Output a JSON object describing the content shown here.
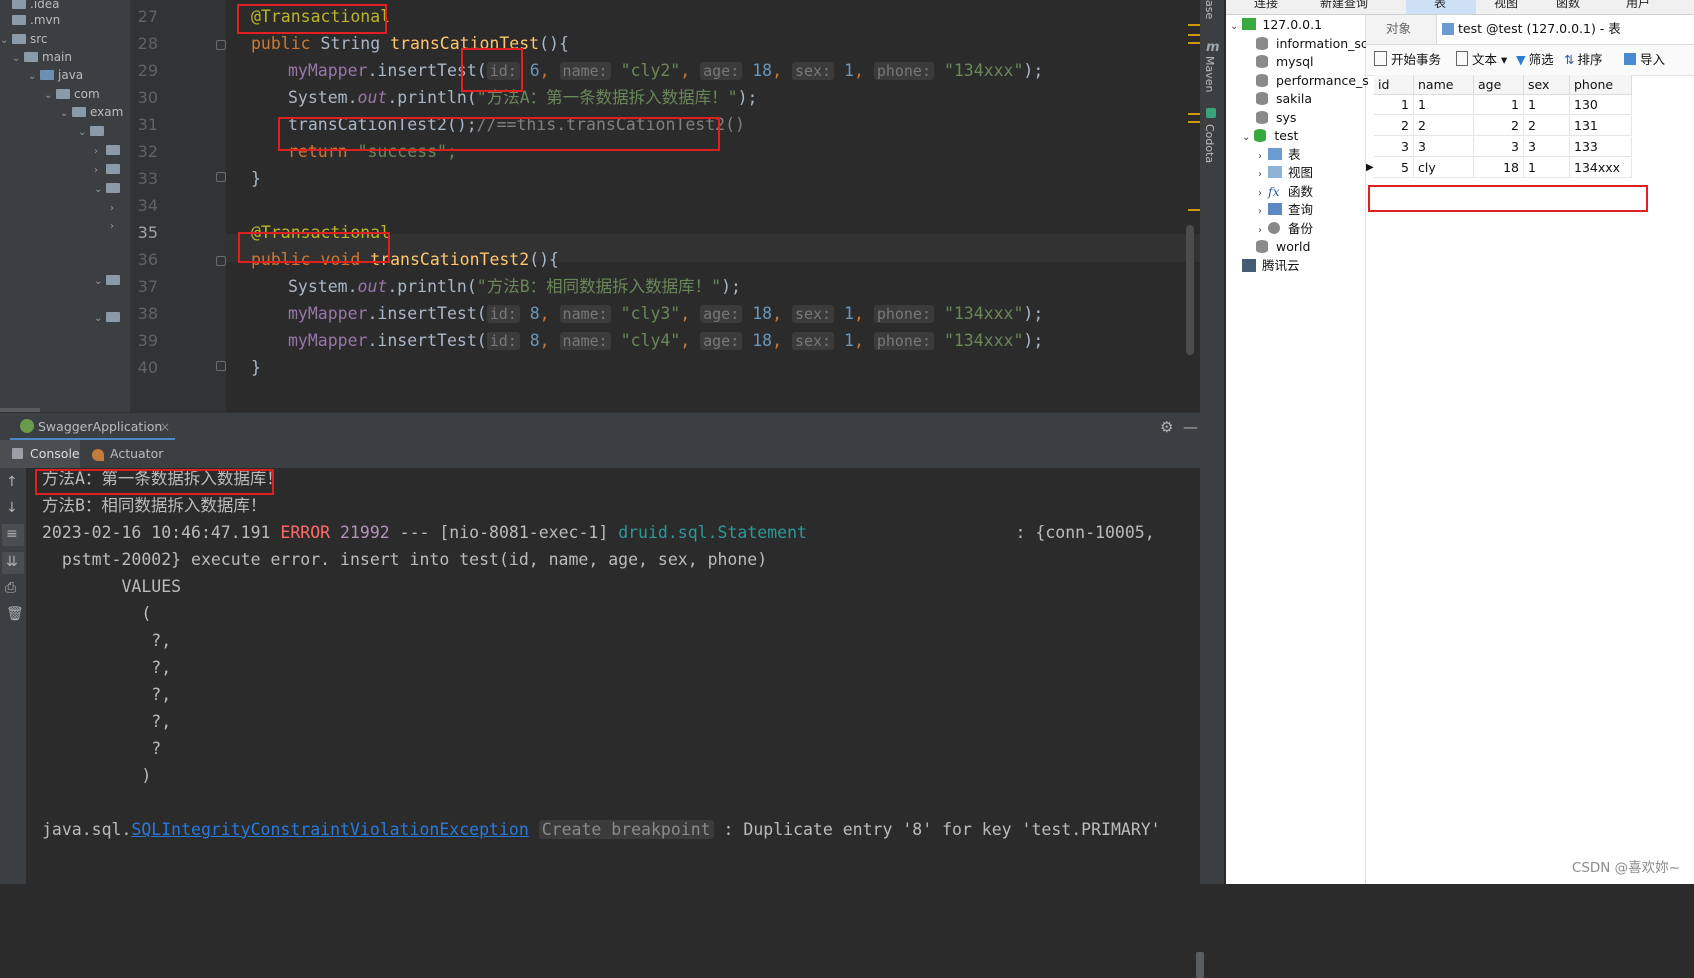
{
  "project_tree": [
    {
      "label": ".idea",
      "indent": 0
    },
    {
      "label": ".mvn",
      "indent": 0
    },
    {
      "label": "src",
      "indent": 0
    },
    {
      "label": "main",
      "indent": 1
    },
    {
      "label": "java",
      "indent": 2
    },
    {
      "label": "com",
      "indent": 3
    },
    {
      "label": "exam",
      "indent": 4
    }
  ],
  "editor": {
    "line_numbers": [
      "27",
      "28",
      "29",
      "30",
      "31",
      "32",
      "33",
      "34",
      "35",
      "36",
      "37",
      "38",
      "39",
      "40"
    ],
    "current_line": "35",
    "annotation_1": "@Transactional",
    "kw_public": "public",
    "type_string": "String",
    "method_a": "transCationTest",
    "parens_open": "(){",
    "mapper": "myMapper",
    "insert": ".insertTest(",
    "hint_id": "id:",
    "hint_name": "name:",
    "hint_age": "age:",
    "hint_sex": "sex:",
    "hint_phone": "phone:",
    "v6": "6",
    "v8": "8",
    "v18": "18",
    "v1": "1",
    "s_cly2": "\"cly2\"",
    "s_cly3": "\"cly3\"",
    "s_cly4": "\"cly4\"",
    "s_phone": "\"134xxx\"",
    "close_stmt": ");",
    "comma": ",",
    "sys": "System.",
    "out": "out",
    "println": ".println(",
    "msg_a": "\"方法A：第一条数据拆入数据库！\"",
    "msg_b": "\"方法B：相同数据拆入数据库！\"",
    "call_b": "transCationTest2();",
    "comment": "//==this.transCationTest2()",
    "kw_return": "return",
    "s_success": "\"success\";",
    "brace_close": "}",
    "annotation_2": "@Transactional",
    "kw_void": "void",
    "method_b": "transCationTest2",
    "sep": "(){"
  },
  "run": {
    "app_tab": "SwaggerApplication",
    "console_tab": "Console",
    "actuator_tab": "Actuator",
    "lines": [
      "方法A：第一条数据拆入数据库！",
      "方法B：相同数据拆入数据库！"
    ],
    "log_prefix": "2023-02-16 10:46:47.191 ",
    "log_level": "ERROR",
    "log_pid": " 21992",
    "log_mid": " --- [nio-8081-exec-1] ",
    "log_class": "druid.sql.Statement",
    "log_tail": "                     : {conn-10005,",
    "log_line2": "  pstmt-20002} execute error. insert into test(id, name, age, sex, phone)",
    "values_kw": "        VALUES",
    "sql_open": "          (",
    "q1": "           ?,",
    "q2": "           ?,",
    "q3": "           ?,",
    "q4": "           ?,",
    "q5": "           ?",
    "sql_close": "          )",
    "exc_prefix": "java.sql.",
    "exc_class": "SQLIntegrityConstraintViolationException",
    "breakpoint": "Create breakpoint",
    "exc_msg": " : Duplicate entry '8' for key 'test.PRIMARY'"
  },
  "ide_side": {
    "database": "ase",
    "maven": "Maven",
    "codota": "Codota"
  },
  "navicat": {
    "top_menu": [
      "连接",
      "新建查询",
      "表",
      "视图",
      "函数",
      "用户"
    ],
    "tree": [
      {
        "label": "127.0.0.1",
        "indent": 0
      },
      {
        "label": "information_sc",
        "indent": 1
      },
      {
        "label": "mysql",
        "indent": 1
      },
      {
        "label": "performance_s",
        "indent": 1
      },
      {
        "label": "sakila",
        "indent": 1
      },
      {
        "label": "sys",
        "indent": 1
      },
      {
        "label": "test",
        "indent": 1
      },
      {
        "label": "表",
        "indent": 2
      },
      {
        "label": "视图",
        "indent": 2
      },
      {
        "label": "函数",
        "indent": 2
      },
      {
        "label": "查询",
        "indent": 2
      },
      {
        "label": "备份",
        "indent": 2
      },
      {
        "label": "world",
        "indent": 1
      },
      {
        "label": "腾讯云",
        "indent": 0
      }
    ],
    "tab_objects": "对象",
    "tab_table": "test @test (127.0.0.1) - 表",
    "toolbar": [
      "开始事务",
      "文本",
      "筛选",
      "排序",
      "导入"
    ],
    "columns": [
      "id",
      "name",
      "age",
      "sex",
      "phone"
    ],
    "rows": [
      [
        "1",
        "1",
        "1",
        "1",
        "130"
      ],
      [
        "2",
        "2",
        "2",
        "2",
        "131"
      ],
      [
        "3",
        "3",
        "3",
        "3",
        "133"
      ],
      [
        "5",
        "cly",
        "18",
        "1",
        "134xxx"
      ]
    ]
  },
  "watermark": "CSDN @喜欢妳~"
}
